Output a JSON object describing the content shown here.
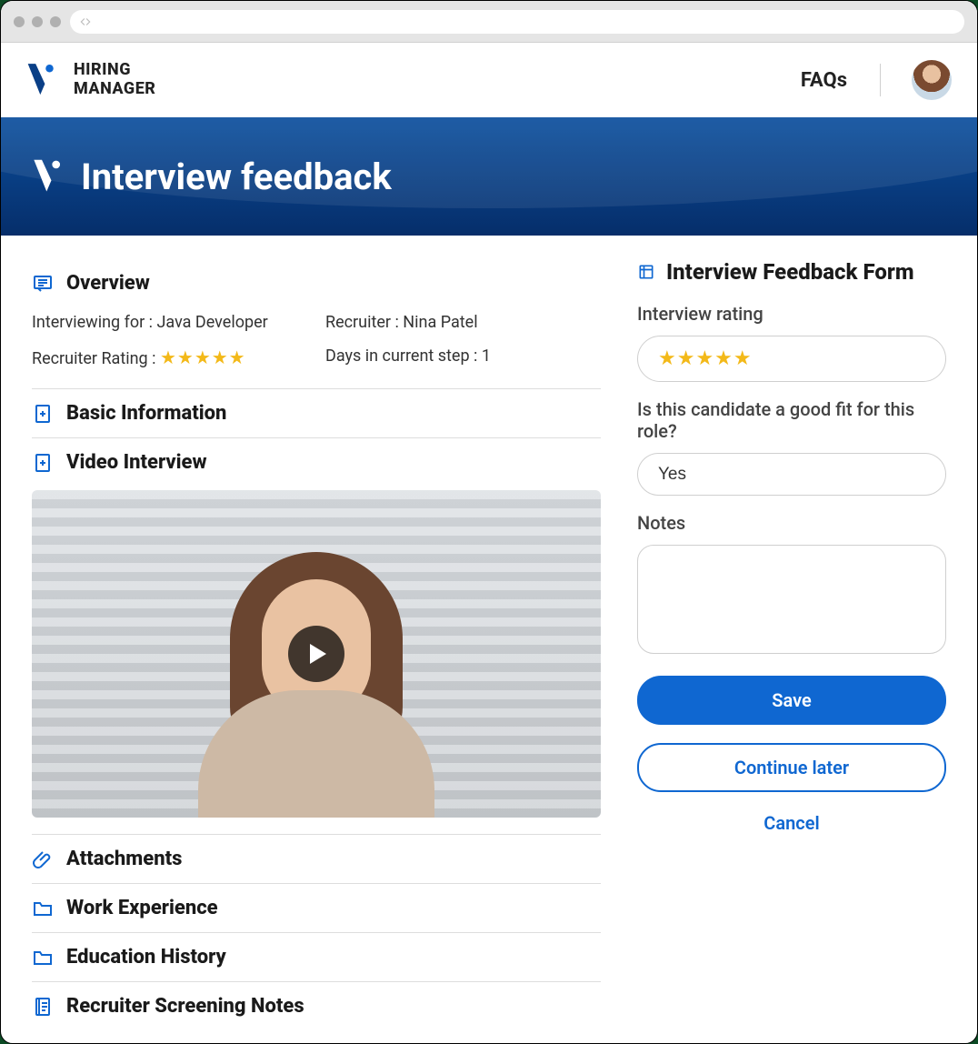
{
  "brand_line1": "HIRING",
  "brand_line2": "MANAGER",
  "nav": {
    "faqs": "FAQs"
  },
  "hero": {
    "title": "Interview feedback"
  },
  "overview": {
    "title": "Overview",
    "interviewing_for_label": "Interviewing for :",
    "interviewing_for_value": "Java Developer",
    "recruiter_label": "Recruiter :",
    "recruiter_value": "Nina Patel",
    "recruiter_rating_label": "Recruiter Rating :",
    "recruiter_rating_stars": 5,
    "days_label": "Days in current step :",
    "days_value": "1"
  },
  "sections": {
    "basic_info": "Basic Information",
    "video_interview": "Video Interview",
    "attachments": "Attachments",
    "work_experience": "Work Experience",
    "education_history": "Education History",
    "recruiter_notes": "Recruiter Screening Notes"
  },
  "form": {
    "title": "Interview Feedback Form",
    "rating_label": "Interview rating",
    "rating_stars": 5,
    "fit_label": "Is this candidate a good fit for this role?",
    "fit_value": "Yes",
    "notes_label": "Notes",
    "notes_value": "",
    "buttons": {
      "save": "Save",
      "later": "Continue later",
      "cancel": "Cancel"
    }
  },
  "colors": {
    "accent": "#0f67d1",
    "star": "#f3b919"
  }
}
